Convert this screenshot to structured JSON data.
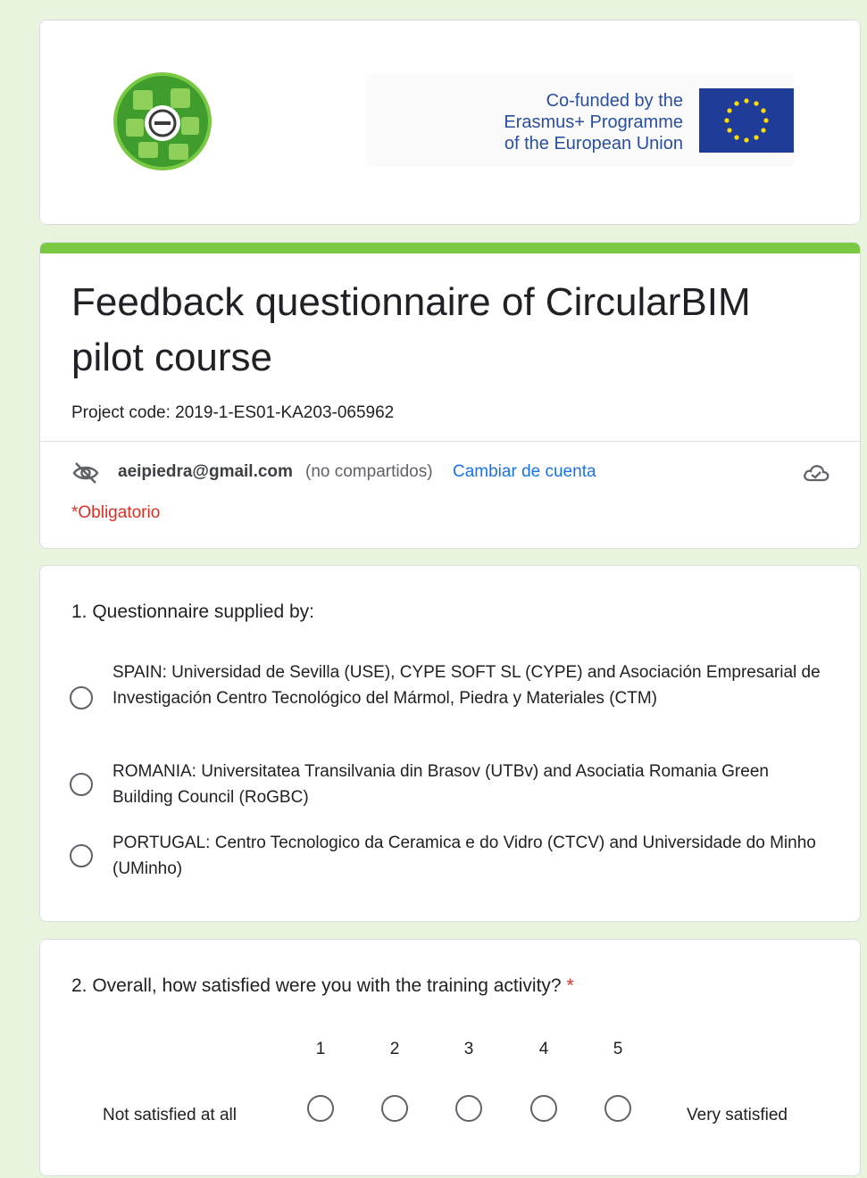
{
  "header": {
    "eu_text_lines": [
      "Co-funded by the",
      "Erasmus+ Programme",
      "of the European Union"
    ]
  },
  "form": {
    "title": "Feedback questionnaire of CircularBIM pilot course",
    "description": "Project code: 2019-1-ES01-KA203-065962",
    "account_email": "aeipiedra@gmail.com",
    "account_note": "(no compartidos)",
    "switch_account": "Cambiar de cuenta",
    "required_note": "*Obligatorio"
  },
  "questions": [
    {
      "title": "1. Questionnaire supplied by:",
      "options": [
        "SPAIN: Universidad de Sevilla (USE), CYPE SOFT SL (CYPE) and Asociación Empresarial de Investigación Centro Tecnológico del Mármol, Piedra y Materiales (CTM)",
        "ROMANIA: Universitatea Transilvania din Brasov (UTBv) and Asociatia Romania Green Building Council (RoGBC)",
        "PORTUGAL: Centro Tecnologico da Ceramica e do Vidro (CTCV) and Universidade do Minho (UMinho)"
      ]
    },
    {
      "title": "2. Overall, how satisfied were you with the training activity?",
      "required_mark": "*",
      "scale": [
        "1",
        "2",
        "3",
        "4",
        "5"
      ],
      "low_label": "Not satisfied at all",
      "high_label": "Very satisfied"
    }
  ],
  "colors": {
    "accent": "#7ac943",
    "background": "#e9f4de",
    "link": "#1a73e8",
    "required": "#d93025",
    "eu_blue": "#1f3c99",
    "eu_text": "#2a4f9e"
  }
}
